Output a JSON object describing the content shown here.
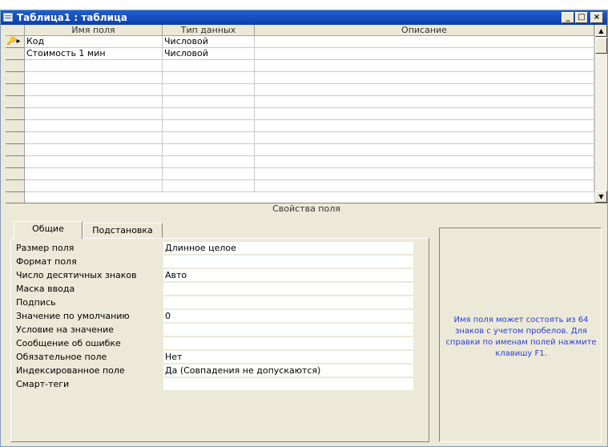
{
  "window": {
    "title": "Таблица1 : таблица"
  },
  "grid": {
    "columns": [
      "Имя поля",
      "Тип данных",
      "Описание"
    ],
    "rows": [
      {
        "name": "Код",
        "type": "Числовой",
        "description": ""
      },
      {
        "name": "Стоимость 1 мин",
        "type": "Числовой",
        "description": ""
      }
    ]
  },
  "properties": {
    "section_title": "Свойства поля",
    "tabs": [
      "Общие",
      "Подстановка"
    ],
    "fields": [
      {
        "label": "Размер поля",
        "value": "Длинное целое"
      },
      {
        "label": "Формат поля",
        "value": ""
      },
      {
        "label": "Число десятичных знаков",
        "value": "Авто"
      },
      {
        "label": "Маска ввода",
        "value": ""
      },
      {
        "label": "Подпись",
        "value": ""
      },
      {
        "label": "Значение по умолчанию",
        "value": "0"
      },
      {
        "label": "Условие на значение",
        "value": ""
      },
      {
        "label": "Сообщение об ошибке",
        "value": ""
      },
      {
        "label": "Обязательное поле",
        "value": "Нет"
      },
      {
        "label": "Индексированное поле",
        "value": "Да (Совпадения не допускаются)"
      },
      {
        "label": "Смарт-теги",
        "value": ""
      }
    ],
    "help_text": "Имя поля может состоять из 64 знаков с учетом пробелов. Для справки по именам полей нажмите клавишу F1."
  },
  "colors": {
    "titlebar": "#0a3fb0",
    "help_text": "#2a3fd8",
    "window_bg": "#ece9d8"
  },
  "icons": [
    "table-icon",
    "minimize-icon",
    "maximize-icon",
    "close-icon",
    "primary-key-icon",
    "scroll-up-icon",
    "scroll-down-icon"
  ]
}
